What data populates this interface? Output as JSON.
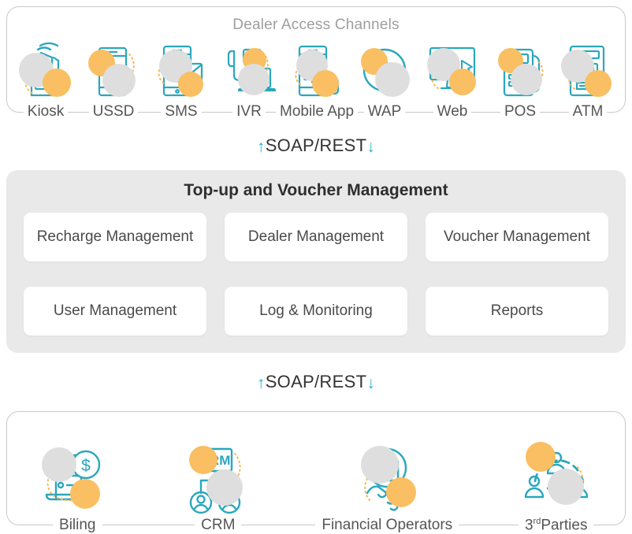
{
  "top_section": {
    "title": "Dealer Access Channels",
    "channels": [
      {
        "label": "Kiosk",
        "icon": "kiosk-icon"
      },
      {
        "label": "USSD",
        "icon": "ussd-icon"
      },
      {
        "label": "SMS",
        "icon": "sms-icon"
      },
      {
        "label": "IVR",
        "icon": "ivr-icon"
      },
      {
        "label": "Mobile App",
        "icon": "mobile-app-icon"
      },
      {
        "label": "WAP",
        "icon": "wap-icon"
      },
      {
        "label": "Web",
        "icon": "web-icon"
      },
      {
        "label": "POS",
        "icon": "pos-icon"
      },
      {
        "label": "ATM",
        "icon": "atm-icon"
      }
    ]
  },
  "connectors": {
    "upper": {
      "up_arrow": "↑",
      "label": "SOAP/REST",
      "down_arrow": "↓"
    },
    "lower": {
      "up_arrow": "↑",
      "label": "SOAP/REST",
      "down_arrow": "↓"
    }
  },
  "core_section": {
    "title": "Top-up and Voucher Management",
    "modules": [
      "Recharge Management",
      "Dealer Management",
      "Voucher Management",
      "User Management",
      "Log & Monitoring",
      "Reports"
    ]
  },
  "bottom_section": {
    "integrations": [
      {
        "label": "Biling",
        "icon": "billing-icon"
      },
      {
        "label": "CRM",
        "icon": "crm-icon"
      },
      {
        "label": "Financial Operators",
        "icon": "handshake-icon"
      },
      {
        "label": "3rd Parties",
        "icon": "third-parties-icon",
        "prefix": "3",
        "superscript": "rd",
        "suffix": "Parties"
      }
    ]
  },
  "colors": {
    "teal": "#2aa7bd",
    "orange": "#f9bf62",
    "gray_blob": "#dedede",
    "panel_gray": "#e9e9e9",
    "border_gray": "#c9c9c9",
    "title_gray": "#9e9e9e",
    "text_dark": "#2e2e2e"
  }
}
